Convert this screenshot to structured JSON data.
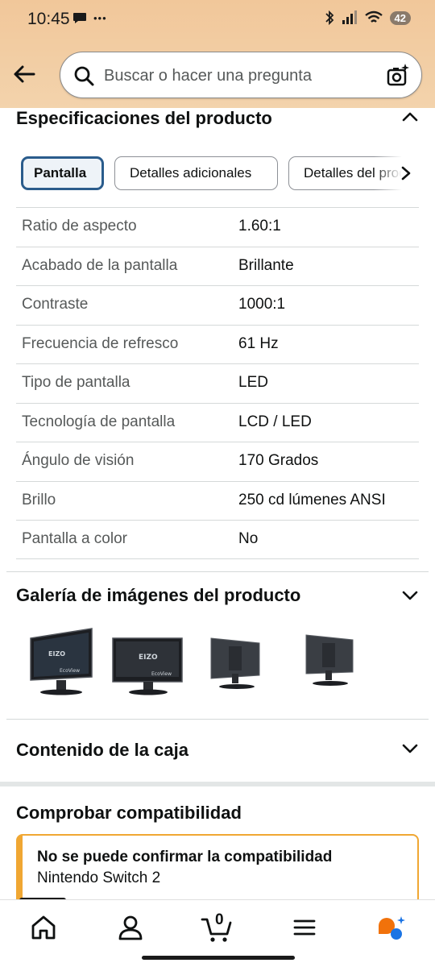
{
  "status_bar": {
    "time": "10:45",
    "dots": "•••",
    "battery": "42"
  },
  "search": {
    "placeholder": "Buscar o hacer una pregunta"
  },
  "specs_section": {
    "title": "Especificaciones del producto",
    "tabs": [
      {
        "label": "Pantalla",
        "active": true
      },
      {
        "label": "Detalles adicionales",
        "active": false
      },
      {
        "label": "Detalles del producto",
        "active": false
      }
    ],
    "rows": [
      {
        "label": "Ratio de aspecto",
        "value": "1.60:1"
      },
      {
        "label": "Acabado de la pantalla",
        "value": "Brillante"
      },
      {
        "label": "Contraste",
        "value": "1000:1"
      },
      {
        "label": "Frecuencia de refresco",
        "value": "61 Hz"
      },
      {
        "label": "Tipo de pantalla",
        "value": "LED"
      },
      {
        "label": "Tecnología de pantalla",
        "value": "LCD / LED"
      },
      {
        "label": "Ángulo de visión",
        "value": "170 Grados"
      },
      {
        "label": "Brillo",
        "value": "250 cd lúmenes ANSI"
      },
      {
        "label": "Pantalla a color",
        "value": "No"
      }
    ]
  },
  "gallery_section": {
    "title": "Galería de imágenes del producto",
    "thumb_brand": "EIZO",
    "thumb_model": "EcoView"
  },
  "box_section": {
    "title": "Contenido de la caja"
  },
  "compat_section": {
    "title": "Comprobar compatibilidad",
    "alert_title": "No se puede confirmar la compatibilidad",
    "alert_device": "Nintendo Switch 2"
  },
  "bottom_nav": {
    "cart_count": "0"
  },
  "colors": {
    "header_bg": "#f1c79a",
    "active_tab_border": "#2a5c8c",
    "alert_border": "#f0a733",
    "rufus_orange": "#f1720b",
    "rufus_blue": "#1b74e4"
  }
}
